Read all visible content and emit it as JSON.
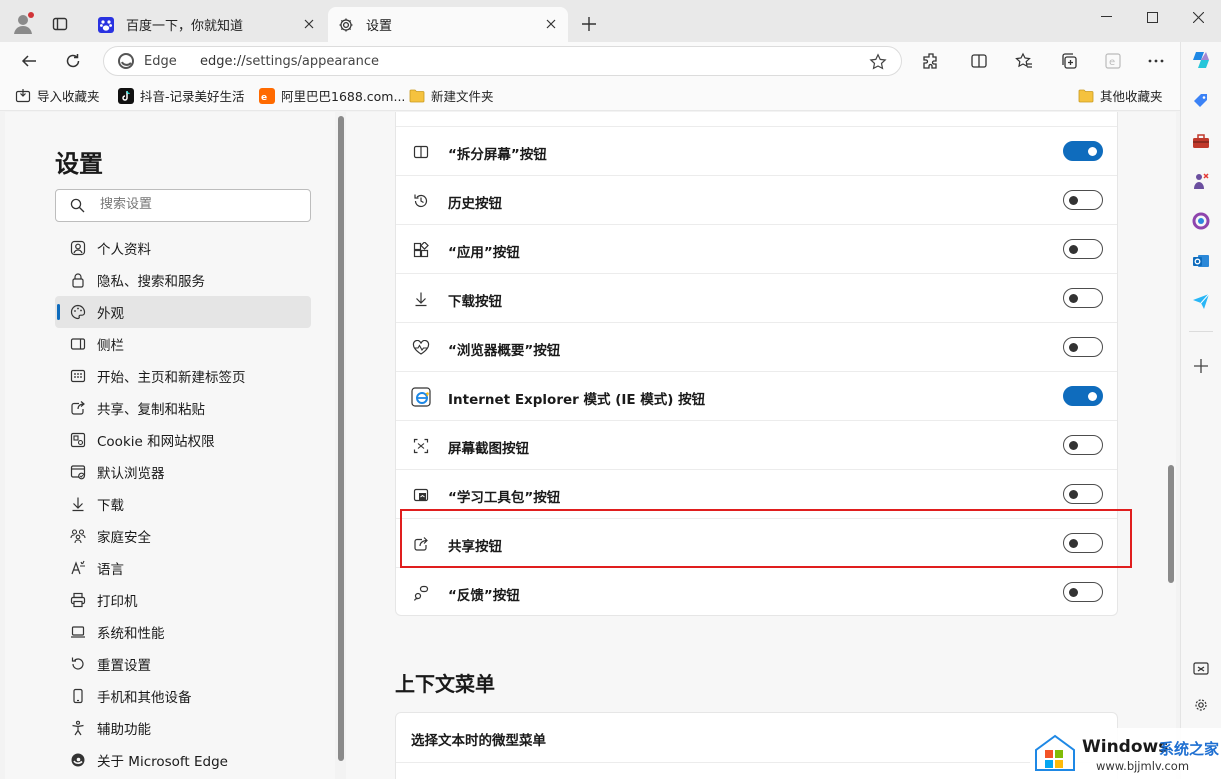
{
  "tabs": [
    {
      "title": "百度一下，你就知道",
      "icon": "baidu-paw-icon",
      "active": false
    },
    {
      "title": "设置",
      "icon": "gear-icon",
      "active": true
    }
  ],
  "address": {
    "site_label": "Edge",
    "url_scheme": "edge://",
    "url_path": "settings/appearance"
  },
  "favorites": {
    "items": [
      {
        "label": "导入收藏夹",
        "icon": "import-favorites-icon"
      },
      {
        "label": "抖音-记录美好生活",
        "icon": "douyin-icon"
      },
      {
        "label": "阿里巴巴1688.com...",
        "icon": "alibaba-1688-icon"
      },
      {
        "label": "新建文件夹",
        "icon": "folder-icon"
      }
    ],
    "other": {
      "label": "其他收藏夹",
      "icon": "folder-icon"
    }
  },
  "settings": {
    "title": "设置",
    "search_placeholder": "搜索设置",
    "nav": [
      {
        "label": "个人资料",
        "icon": "profile-icon"
      },
      {
        "label": "隐私、搜索和服务",
        "icon": "lock-icon"
      },
      {
        "label": "外观",
        "icon": "palette-icon",
        "selected": true
      },
      {
        "label": "侧栏",
        "icon": "sidebar-icon"
      },
      {
        "label": "开始、主页和新建标签页",
        "icon": "home-icon"
      },
      {
        "label": "共享、复制和粘贴",
        "icon": "share-icon"
      },
      {
        "label": "Cookie 和网站权限",
        "icon": "cookie-icon"
      },
      {
        "label": "默认浏览器",
        "icon": "browser-icon"
      },
      {
        "label": "下载",
        "icon": "download-icon"
      },
      {
        "label": "家庭安全",
        "icon": "family-icon"
      },
      {
        "label": "语言",
        "icon": "language-icon"
      },
      {
        "label": "打印机",
        "icon": "printer-icon"
      },
      {
        "label": "系统和性能",
        "icon": "laptop-icon"
      },
      {
        "label": "重置设置",
        "icon": "reset-icon"
      },
      {
        "label": "手机和其他设备",
        "icon": "phone-icon"
      },
      {
        "label": "辅助功能",
        "icon": "accessibility-icon"
      },
      {
        "label": "关于 Microsoft Edge",
        "icon": "edge-icon"
      }
    ]
  },
  "toolbar_buttons": [
    {
      "label": "“拆分屏幕”按钮",
      "icon": "split-screen-icon",
      "on": true
    },
    {
      "label": "历史按钮",
      "icon": "history-icon",
      "on": false
    },
    {
      "label": "“应用”按钮",
      "icon": "apps-icon",
      "on": false
    },
    {
      "label": "下载按钮",
      "icon": "download-icon",
      "on": false
    },
    {
      "label": "“浏览器概要”按钮",
      "icon": "heartbeat-icon",
      "on": false
    },
    {
      "label": "Internet Explorer 模式 (IE 模式) 按钮",
      "icon": "ie-icon",
      "on": true
    },
    {
      "label": "屏幕截图按钮",
      "icon": "screenshot-icon",
      "on": false
    },
    {
      "label": "“学习工具包”按钮",
      "icon": "learning-toolkit-icon",
      "on": false
    },
    {
      "label": "共享按钮",
      "icon": "share-icon",
      "on": false,
      "highlighted": true
    },
    {
      "label": "“反馈”按钮",
      "icon": "feedback-icon",
      "on": false
    }
  ],
  "context_menu": {
    "title": "上下文菜单",
    "items": [
      {
        "label": "选择文本时的微型菜单"
      }
    ]
  },
  "watermark": {
    "brand": "Windows",
    "cn": "系统之家",
    "url": "www.bjjmlv.com"
  },
  "colors": {
    "accent": "#0f6cbd",
    "highlight": "#e01e1e"
  }
}
